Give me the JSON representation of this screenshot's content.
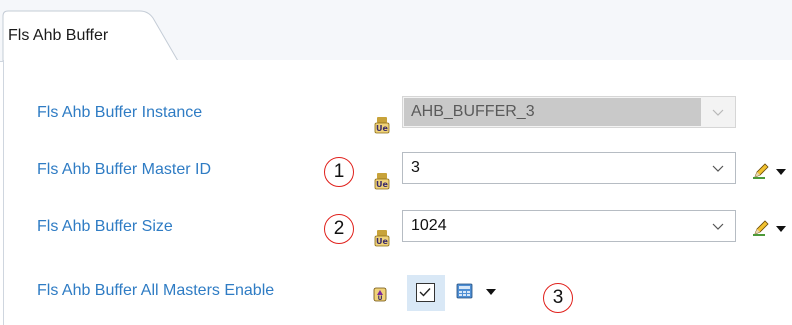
{
  "tab": {
    "label": "Fls Ahb Buffer"
  },
  "rows": {
    "instance": {
      "label": "Fls Ahb Buffer Instance",
      "value": "AHB_BUFFER_3"
    },
    "master_id": {
      "label": "Fls Ahb Buffer Master ID",
      "value": "3",
      "callout": "1"
    },
    "size": {
      "label": "Fls Ahb Buffer Size",
      "value": "1024",
      "callout": "2"
    },
    "all_masters": {
      "label": "Fls Ahb Buffer All Masters Enable",
      "checked": true,
      "callout": "3"
    }
  },
  "icons": {
    "field_type": "variable-icon",
    "edit": "pencil-icon",
    "options": "calculator-icon",
    "dropdown": "chevron-down-icon"
  },
  "colors": {
    "label": "#2f7cc4",
    "callout": "#e0201b",
    "checkbox_highlight": "#d9e8f6",
    "disabled_field": "#c9c9c9"
  }
}
